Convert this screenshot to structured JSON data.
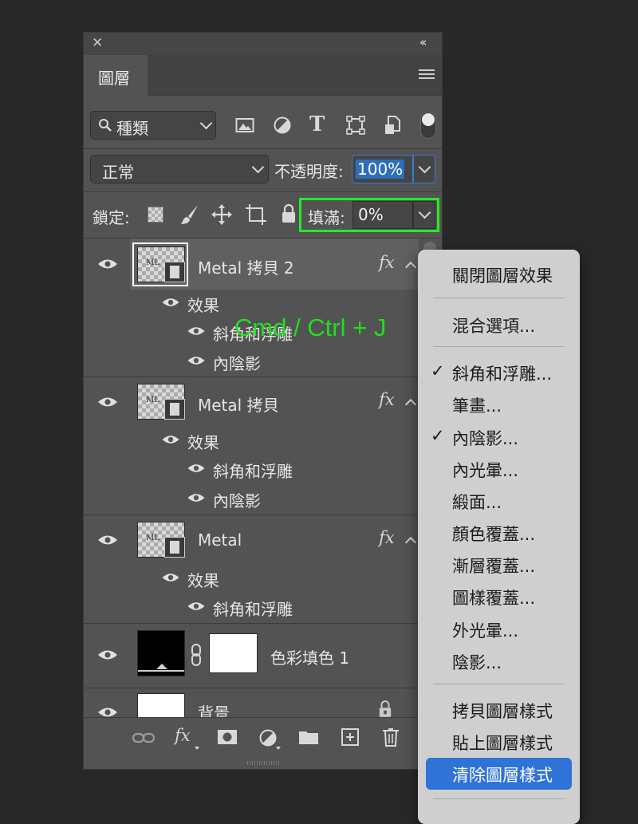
{
  "panel": {
    "tab_label": "圖層",
    "filter": {
      "label": "種類"
    },
    "blend_mode": "正常",
    "opacity_label": "不透明度:",
    "opacity_value": "100%",
    "lock_label": "鎖定:",
    "fill_label": "填滿:",
    "fill_value": "0%"
  },
  "annotation": {
    "text": "Cmd / Ctrl + J",
    "color": "#22dd22"
  },
  "layers": [
    {
      "name": "Metal 拷貝 2",
      "effects_label": "效果",
      "effects": [
        "斜角和浮雕",
        "內陰影"
      ]
    },
    {
      "name": "Metal 拷貝",
      "effects_label": "效果",
      "effects": [
        "斜角和浮雕",
        "內陰影"
      ]
    },
    {
      "name": "Metal",
      "effects_label": "效果",
      "effects": [
        "斜角和浮雕"
      ]
    },
    {
      "name": "色彩填色 1"
    },
    {
      "name": "背景"
    }
  ],
  "fx_label": "fx",
  "thumb_text": "ML",
  "menu": {
    "items": [
      {
        "label": "關閉圖層效果"
      },
      {
        "label": "混合選項..."
      },
      {
        "label": "斜角和浮雕...",
        "checked": true
      },
      {
        "label": "筆畫..."
      },
      {
        "label": "內陰影...",
        "checked": true
      },
      {
        "label": "內光暈..."
      },
      {
        "label": "緞面..."
      },
      {
        "label": "顏色覆蓋..."
      },
      {
        "label": "漸層覆蓋..."
      },
      {
        "label": "圖樣覆蓋..."
      },
      {
        "label": "外光暈..."
      },
      {
        "label": "陰影..."
      },
      {
        "label": "拷貝圖層樣式"
      },
      {
        "label": "貼上圖層樣式"
      },
      {
        "label": "清除圖層樣式",
        "highlighted": true
      }
    ],
    "checkmark": "✓"
  },
  "colors": {
    "highlight": "#2f73d6",
    "fill_outline": "#22ee22",
    "opacity_highlight": "#2d6fb8"
  }
}
